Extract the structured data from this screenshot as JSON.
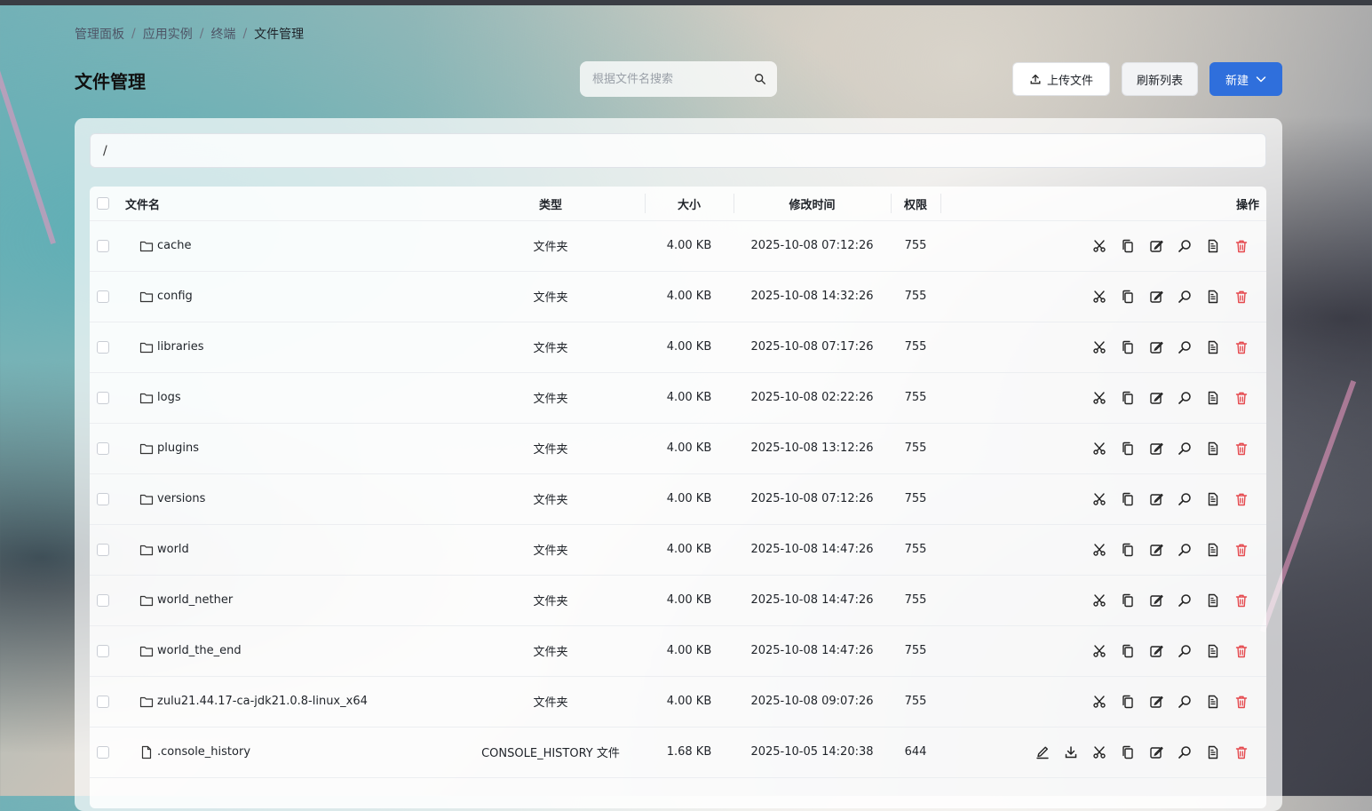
{
  "breadcrumb": [
    "管理面板",
    "应用实例",
    "终端",
    "文件管理"
  ],
  "page_title": "文件管理",
  "search": {
    "placeholder": "根据文件名搜索",
    "value": ""
  },
  "toolbar": {
    "upload_label": "上传文件",
    "refresh_label": "刷新列表",
    "new_label": "新建"
  },
  "path": "/",
  "table": {
    "headers": {
      "name": "文件名",
      "type": "类型",
      "size": "大小",
      "mtime": "修改时间",
      "perm": "权限",
      "ops": "操作"
    },
    "rows": [
      {
        "name": "cache",
        "kind": "folder",
        "type": "文件夹",
        "size": "4.00 KB",
        "mtime": "2025-10-08 07:12:26",
        "perm": "755"
      },
      {
        "name": "config",
        "kind": "folder",
        "type": "文件夹",
        "size": "4.00 KB",
        "mtime": "2025-10-08 14:32:26",
        "perm": "755"
      },
      {
        "name": "libraries",
        "kind": "folder",
        "type": "文件夹",
        "size": "4.00 KB",
        "mtime": "2025-10-08 07:17:26",
        "perm": "755"
      },
      {
        "name": "logs",
        "kind": "folder",
        "type": "文件夹",
        "size": "4.00 KB",
        "mtime": "2025-10-08 02:22:26",
        "perm": "755"
      },
      {
        "name": "plugins",
        "kind": "folder",
        "type": "文件夹",
        "size": "4.00 KB",
        "mtime": "2025-10-08 13:12:26",
        "perm": "755"
      },
      {
        "name": "versions",
        "kind": "folder",
        "type": "文件夹",
        "size": "4.00 KB",
        "mtime": "2025-10-08 07:12:26",
        "perm": "755"
      },
      {
        "name": "world",
        "kind": "folder",
        "type": "文件夹",
        "size": "4.00 KB",
        "mtime": "2025-10-08 14:47:26",
        "perm": "755"
      },
      {
        "name": "world_nether",
        "kind": "folder",
        "type": "文件夹",
        "size": "4.00 KB",
        "mtime": "2025-10-08 14:47:26",
        "perm": "755"
      },
      {
        "name": "world_the_end",
        "kind": "folder",
        "type": "文件夹",
        "size": "4.00 KB",
        "mtime": "2025-10-08 14:47:26",
        "perm": "755"
      },
      {
        "name": "zulu21.44.17-ca-jdk21.0.8-linux_x64",
        "kind": "folder",
        "type": "文件夹",
        "size": "4.00 KB",
        "mtime": "2025-10-08 09:07:26",
        "perm": "755"
      },
      {
        "name": ".console_history",
        "kind": "file",
        "type": "CONSOLE_HISTORY 文件",
        "size": "1.68 KB",
        "mtime": "2025-10-05 14:20:38",
        "perm": "644"
      }
    ]
  },
  "icons": {
    "folder_ops": [
      "scissors-icon",
      "copy-icon",
      "rename-icon",
      "search-icon",
      "permission-icon",
      "delete-icon"
    ],
    "file_ops": [
      "edit-icon",
      "download-icon",
      "scissors-icon",
      "copy-icon",
      "rename-icon",
      "search-icon",
      "permission-icon",
      "delete-icon"
    ]
  },
  "colors": {
    "primary": "#2f6fdc",
    "danger": "#e5484d"
  }
}
